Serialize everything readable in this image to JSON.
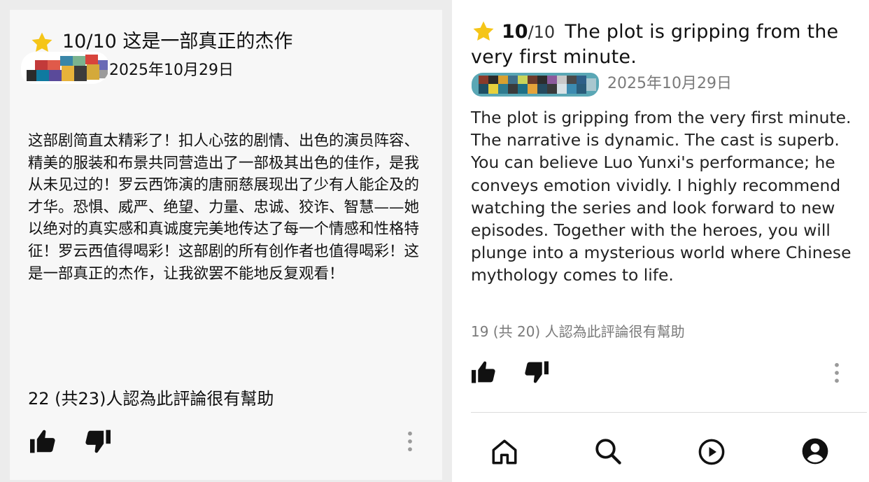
{
  "left_review": {
    "rating": "10/10",
    "title": "这是一部真正的杰作",
    "date": "2025年10月29日",
    "body": "这部剧简直太精彩了！扣人心弦的剧情、出色的演员阵容、精美的服装和布景共同营造出了一部极其出色的佳作，是我从未见过的！罗云西饰演的唐丽慈展现出了少有人能企及的才华。恐惧、威严、绝望、力量、忠诚、狡诈、智慧——她以绝对的真实感和真诚度完美地传达了每一个情感和性格特征！罗云西值得喝彩！这部剧的所有创作者也值得喝彩！这是一部真正的杰作，让我欲罢不能地反复观看！",
    "helpful": "22 (共23)人認為此評論很有幫助",
    "icons": [
      "star-icon",
      "thumbs-up-icon",
      "thumbs-down-icon",
      "more-vertical-icon"
    ]
  },
  "right_review": {
    "score": "10",
    "outof": "/10",
    "title": "The plot is gripping from the very first minute.",
    "date": "2025年10月29日",
    "body": "The plot is gripping from the very first minute. The narrative is dynamic. The cast is superb. You can believe Luo Yunxi's performance; he conveys emotion vividly. I highly recommend watching the series and look forward to new episodes. Together with the heroes, you will plunge into a mysterious world where Chinese mythology comes to life.",
    "helpful": "19 (共 20) 人認為此評論很有幫助",
    "icons": [
      "star-icon",
      "thumbs-up-icon",
      "thumbs-down-icon",
      "more-vertical-icon"
    ]
  },
  "bottom_nav": {
    "items": [
      "home-icon",
      "search-icon",
      "play-circle-icon",
      "profile-icon"
    ]
  },
  "colors": {
    "star": "#f5c518",
    "text": "#111111",
    "muted": "#7a7a7a",
    "icon": "#111111"
  }
}
